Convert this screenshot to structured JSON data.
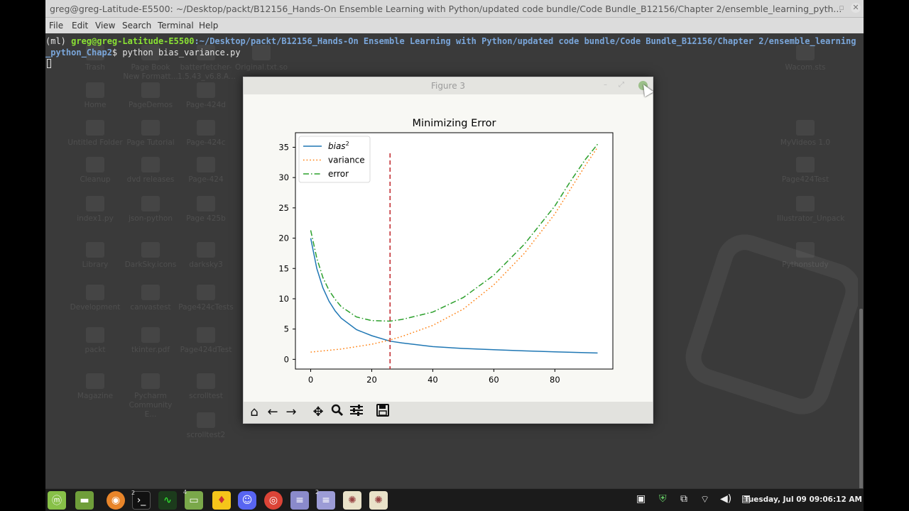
{
  "terminal": {
    "title": "greg@greg-Latitude-E5500: ~/Desktop/packt/B12156_Hands-On Ensemble Learning with Python/updated code bundle/Code Bundle_B12156/Chapter 2/ensemble_learning_pyth...",
    "menu": [
      "File",
      "Edit",
      "View",
      "Search",
      "Terminal",
      "Help"
    ],
    "prompt_env": "(ml) ",
    "prompt_user": "greg@greg-Latitude-E5500",
    "prompt_path_1": ":~/Desktop/packt/B12156_Hands-On Ensemble Learning with Python/updated code bundle/Code Bundle_B12156/Chapter 2/ensemble_learning",
    "prompt_path_2": "_python_Chap2",
    "prompt_symbol": "$ ",
    "command": "python bias_variance.py"
  },
  "desktop_icons": [
    "Trash",
    "Page Book New Formatt...",
    "batterfetcher-1.5.43_v6.8.A...",
    "Original.txt.so",
    "Home",
    "PageDemos",
    "Page-424d",
    "Untitled Folder",
    "Page Tutorial",
    "Page-424c",
    "Cleanup",
    "dvd releases",
    "Page-424",
    "index1.py",
    "json-python",
    "Page 425b",
    "Library",
    "DarkSky.icons",
    "darksky3",
    "Development",
    "canvastest",
    "Page424cTests",
    "packt",
    "tkinter.pdf",
    "Page424dTest",
    "Magazine",
    "Pycharm Community E...",
    "scrolltest",
    "scrolltest2",
    "Wacom.sts",
    "MyVideos 1.0",
    "Page424Test",
    "Illustrator_Unpack",
    "Pythonstudy"
  ],
  "figure": {
    "window_title": "Figure 3",
    "toolbar": {
      "home": "home-icon",
      "back": "back-arrow-icon",
      "forward": "forward-arrow-icon",
      "pan": "pan-move-icon",
      "zoom": "zoom-magnifier-icon",
      "configure": "configure-subplots-icon",
      "save": "save-floppy-icon"
    }
  },
  "chart_data": {
    "type": "line",
    "title": "Minimizing Error",
    "xlabel": "",
    "ylabel": "",
    "xlim": [
      -5,
      99
    ],
    "ylim": [
      -1.6,
      37.4
    ],
    "xticks": [
      0,
      20,
      40,
      60,
      80
    ],
    "yticks": [
      0,
      5,
      10,
      15,
      20,
      25,
      30,
      35
    ],
    "legend_position": "top-left",
    "grid": false,
    "series": [
      {
        "name": "bias",
        "name_superscript": "2",
        "style": "solid",
        "color": "#1f77b4",
        "x": [
          0,
          2,
          4,
          6,
          8,
          10,
          15,
          20,
          26,
          30,
          40,
          50,
          60,
          70,
          80,
          94
        ],
        "y": [
          20.0,
          15.0,
          11.8,
          9.6,
          8.0,
          6.8,
          4.9,
          3.9,
          3.0,
          2.7,
          2.1,
          1.8,
          1.6,
          1.4,
          1.25,
          1.05
        ]
      },
      {
        "name": "variance",
        "style": "dotted",
        "color": "#ff7f0e",
        "x": [
          0,
          10,
          20,
          26,
          30,
          40,
          50,
          60,
          70,
          80,
          85,
          90,
          94
        ],
        "y": [
          1.2,
          1.7,
          2.5,
          3.2,
          3.8,
          5.6,
          8.3,
          12.3,
          17.5,
          24.0,
          28.0,
          32.0,
          35.0
        ]
      },
      {
        "name": "error",
        "style": "dashdot",
        "color": "#2ca02c",
        "x": [
          0,
          2,
          4,
          6,
          8,
          10,
          15,
          20,
          26,
          30,
          40,
          50,
          60,
          70,
          80,
          85,
          90,
          94
        ],
        "y": [
          21.3,
          16.7,
          13.5,
          11.4,
          9.9,
          8.7,
          7.0,
          6.4,
          6.3,
          6.6,
          7.8,
          10.2,
          13.9,
          19.0,
          25.3,
          29.3,
          33.0,
          35.5
        ]
      }
    ],
    "vertical_line": {
      "x": 26,
      "y_top": 34,
      "style": "dashed",
      "color": "#c0262b"
    }
  },
  "taskbar": {
    "apps": [
      "mint-menu-icon",
      "files-icon",
      "firefox-icon",
      "terminal-icon",
      "system-monitor-icon",
      "folder-icon",
      "app-icon",
      "discord-icon",
      "chrome-icon",
      "text-editor-icon",
      "notes-icon",
      "gimp-icon",
      "gimp-icon-2"
    ],
    "badges": {
      "terminal": "2",
      "folder": "4",
      "notes": "2"
    },
    "clock": "Tuesday, Jul 09 09:06:12 AM"
  }
}
